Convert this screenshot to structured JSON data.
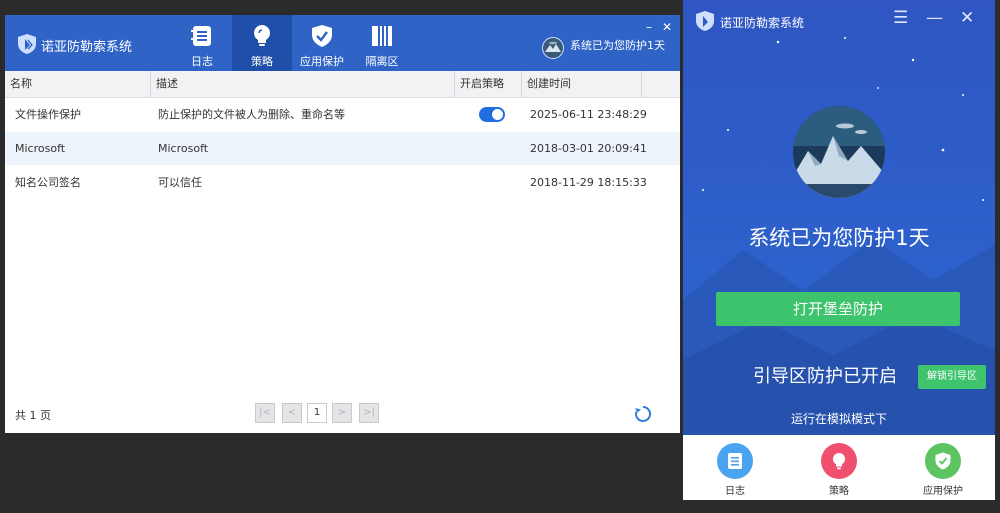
{
  "main_window": {
    "app_title": "诺亚防勒索系统",
    "tabs": [
      {
        "label": "日志",
        "icon": "log-icon"
      },
      {
        "label": "策略",
        "icon": "bulb-icon",
        "active": true
      },
      {
        "label": "应用保护",
        "icon": "shield-icon"
      },
      {
        "label": "隔离区",
        "icon": "quarantine-icon"
      }
    ],
    "status_text": "系统已为您防护1天",
    "columns": [
      "名称",
      "描述",
      "开启策略",
      "创建时间"
    ],
    "rows": [
      {
        "name": "文件操作保护",
        "desc": "防止保护的文件被人为删除、重命名等",
        "enabled": true,
        "created": "2025-06-11 23:48:29"
      },
      {
        "name": "Microsoft",
        "desc": "Microsoft",
        "enabled": null,
        "created": "2018-03-01 20:09:41"
      },
      {
        "name": "知名公司签名",
        "desc": "可以信任",
        "enabled": null,
        "created": "2018-11-29 18:15:33"
      }
    ],
    "footer": {
      "total": "共 1 页",
      "current_page": "1",
      "first": "|<",
      "prev": "<",
      "next": ">",
      "last": ">|"
    }
  },
  "side_window": {
    "title": "诺亚防勒索系统",
    "protect_days_text": "系统已为您防护1天",
    "open_button": "打开堡垒防护",
    "boot_text": "引导区防护已开启",
    "unlock_button": "解锁引导区",
    "mode_text": "运行在模拟模式下",
    "bottom_nav": [
      {
        "label": "日志",
        "color": "#4aa3ee",
        "icon": "log-icon"
      },
      {
        "label": "策略",
        "color": "#f0506e",
        "icon": "bulb-icon"
      },
      {
        "label": "应用保护",
        "color": "#5cc460",
        "icon": "shield-icon"
      }
    ]
  },
  "colors": {
    "header_blue": "#2f63c6",
    "active_tab": "#1f4fa8",
    "toggle_blue": "#1f6fe0",
    "green_button": "#3ec46d"
  }
}
